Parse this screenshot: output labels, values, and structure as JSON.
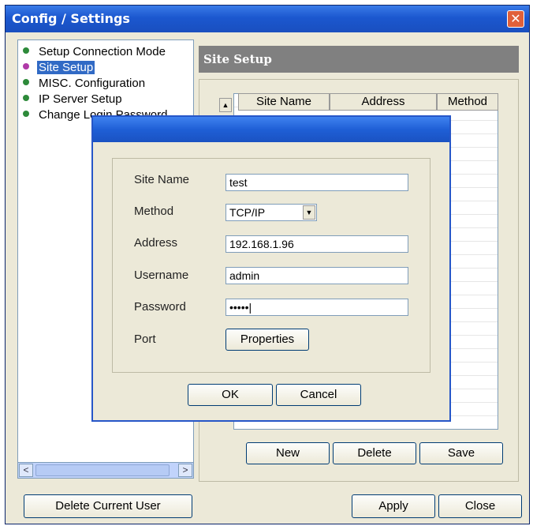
{
  "window": {
    "title": "Config / Settings",
    "close_glyph": "✕"
  },
  "tree": {
    "items": [
      {
        "label": "Setup Connection Mode",
        "selected": false
      },
      {
        "label": "Site Setup",
        "selected": true
      },
      {
        "label": "MISC. Configuration",
        "selected": false
      },
      {
        "label": "IP Server Setup",
        "selected": false
      },
      {
        "label": "Change Login Password",
        "selected": false
      }
    ],
    "scroll_left": "<",
    "scroll_right": ">"
  },
  "site_setup": {
    "header": "Site Setup",
    "table": {
      "corner_glyph": "▲",
      "columns": [
        "Site Name",
        "Address",
        "Method"
      ]
    },
    "buttons": {
      "new": "New",
      "delete": "Delete",
      "save": "Save"
    }
  },
  "footer": {
    "delete_user": "Delete Current User",
    "apply": "Apply",
    "close": "Close"
  },
  "dialog": {
    "fields": {
      "site_name": {
        "label": "Site Name",
        "value": "test"
      },
      "method": {
        "label": "Method",
        "value": "TCP/IP",
        "arrow": "▼"
      },
      "address": {
        "label": "Address",
        "value": "192.168.1.96"
      },
      "username": {
        "label": "Username",
        "value": "admin"
      },
      "password": {
        "label": "Password",
        "value": "•••••|"
      },
      "port": {
        "label": "Port",
        "button": "Properties"
      }
    },
    "ok": "OK",
    "cancel": "Cancel"
  },
  "colors": {
    "titlebar": "#1b57cf",
    "selection": "#316ac5",
    "header_gray": "#808080",
    "face": "#ece9d8"
  }
}
